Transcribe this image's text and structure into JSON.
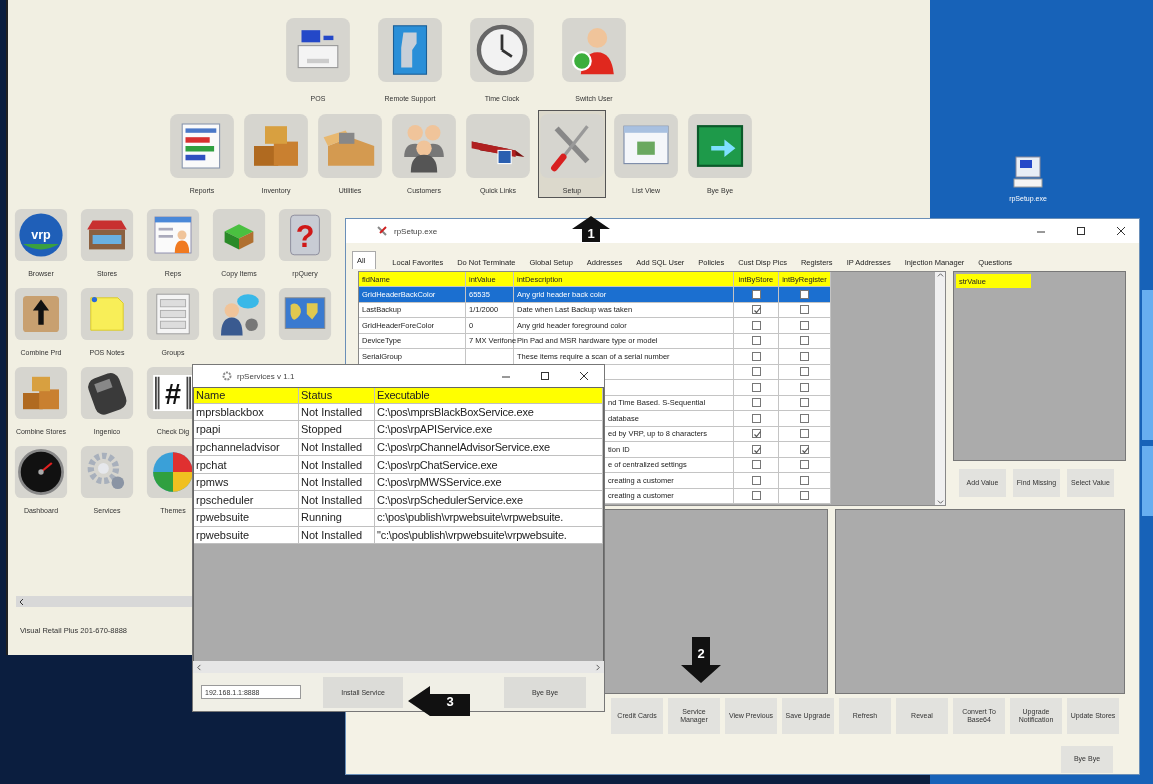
{
  "app": {
    "top_launchers": [
      {
        "label": "POS",
        "selected": false
      },
      {
        "label": "Remote Support",
        "selected": false
      },
      {
        "label": "Time Clock",
        "selected": false
      },
      {
        "label": "Switch User",
        "selected": false
      }
    ],
    "main_launchers": [
      {
        "label": "Reports",
        "selected": false
      },
      {
        "label": "Inventory",
        "selected": false
      },
      {
        "label": "Utilities",
        "selected": false
      },
      {
        "label": "Customers",
        "selected": false
      },
      {
        "label": "Quick Links",
        "selected": false
      },
      {
        "label": "Setup",
        "selected": true
      },
      {
        "label": "List View",
        "selected": false
      },
      {
        "label": "Bye Bye",
        "selected": false
      }
    ],
    "side_launchers": [
      {
        "label": "Browser",
        "badge": "vrp"
      },
      {
        "label": "Stores"
      },
      {
        "label": "Reps"
      },
      {
        "label": "Copy Items"
      },
      {
        "label": "rpQuery",
        "badge": "?"
      },
      {
        "label": "Combine Prd"
      },
      {
        "label": "POS Notes"
      },
      {
        "label": "Groups"
      },
      {
        "label": "Combine Stores"
      },
      {
        "label": "Ingenico"
      },
      {
        "label": "Check Dig",
        "badge": "#"
      },
      {
        "label": "Dashboard"
      },
      {
        "label": "Services"
      },
      {
        "label": "Themes"
      }
    ],
    "status_text": "Visual Retail Plus 201-670-8888"
  },
  "desktop_icons": [
    {
      "label": "rpSetup.exe"
    }
  ],
  "setup_window": {
    "title": "rpSetup.exe",
    "tabs": [
      {
        "label": "All",
        "selected": true
      },
      {
        "label": "Local Favorites",
        "selected": false
      },
      {
        "label": "Do Not Terminate",
        "selected": false
      },
      {
        "label": "Global Setup",
        "selected": false
      },
      {
        "label": "Addresses",
        "selected": false
      },
      {
        "label": "Add SQL User",
        "selected": false
      },
      {
        "label": "Policies",
        "selected": false
      },
      {
        "label": "Cust Disp Pics",
        "selected": false
      },
      {
        "label": "Registers",
        "selected": false
      },
      {
        "label": "IP Addresses",
        "selected": false
      },
      {
        "label": "Injection Manager",
        "selected": false
      },
      {
        "label": "Questions",
        "selected": false
      }
    ],
    "grid": {
      "columns": [
        "fldName",
        "intValue",
        "intDescription",
        "intByStore",
        "intByRegister"
      ],
      "rows": [
        {
          "kind": "full",
          "name": "GridHeaderBackColor",
          "value": "65535",
          "description": "Any grid header back color",
          "by_store": false,
          "by_register": false,
          "selected": true
        },
        {
          "kind": "full",
          "name": "LastBackup",
          "value": "1/1/2000",
          "description": "Date when Last Backup was taken",
          "by_store": true,
          "by_register": false,
          "selected": false
        },
        {
          "kind": "full",
          "name": "GridHeaderForeColor",
          "value": "0",
          "description": "Any grid header foreground color",
          "by_store": false,
          "by_register": false,
          "selected": false
        },
        {
          "kind": "full",
          "name": "DeviceType",
          "value": "7 MX Verifone",
          "description": "Pin Pad and MSR hardware type or model",
          "by_store": false,
          "by_register": false,
          "selected": false
        },
        {
          "kind": "full",
          "name": "SerialGroup",
          "description": "These items require a scan of a serial number",
          "by_store": false,
          "by_register": false,
          "selected": false
        },
        {
          "kind": "covered",
          "by_store": false,
          "by_register": false,
          "selected": false
        },
        {
          "kind": "covered",
          "by_store": false,
          "by_register": false,
          "selected": false
        },
        {
          "kind": "covered",
          "description": "nd Time Based. S-Sequential",
          "by_store": false,
          "by_register": false,
          "selected": false
        },
        {
          "kind": "covered",
          "description": "database",
          "by_store": false,
          "by_register": false,
          "selected": false
        },
        {
          "kind": "covered",
          "description": "ed by VRP, up to 8 characters",
          "by_store": true,
          "by_register": false,
          "selected": false
        },
        {
          "kind": "covered",
          "description": "tion ID",
          "by_store": true,
          "by_register": true,
          "selected": false
        },
        {
          "kind": "covered",
          "description": "e of centralized settings",
          "by_store": false,
          "by_register": false,
          "selected": false
        },
        {
          "kind": "covered",
          "description": "creating a customer",
          "by_store": false,
          "by_register": false,
          "selected": false
        },
        {
          "kind": "covered",
          "description": "creating a customer",
          "by_store": false,
          "by_register": false,
          "selected": false
        }
      ]
    },
    "value_panel": {
      "column": "strValue"
    },
    "value_buttons": [
      "Add Value",
      "Find Missing",
      "Select Value"
    ],
    "buttons": [
      "Credit Cards",
      "Service Manager",
      "View Previous",
      "Save Upgrade",
      "Refresh",
      "Reveal",
      "Convert To Base64",
      "Upgrade Notification",
      "Update Stores"
    ],
    "close_button": "Bye Bye"
  },
  "services_window": {
    "title": "rpServices v 1.1",
    "columns": [
      "Name",
      "Status",
      "Executable"
    ],
    "rows": [
      {
        "name": "mprsblackbox",
        "status": "Not Installed",
        "executable": "C:\\pos\\mprsBlackBoxService.exe"
      },
      {
        "name": "rpapi",
        "status": "Stopped",
        "executable": "C:\\pos\\rpAPIService.exe"
      },
      {
        "name": "rpchanneladvisor",
        "status": "Not Installed",
        "executable": "C:\\pos\\rpChannelAdvisorService.exe"
      },
      {
        "name": "rpchat",
        "status": "Not Installed",
        "executable": "C:\\pos\\rpChatService.exe"
      },
      {
        "name": "rpmws",
        "status": "Not Installed",
        "executable": "C:\\pos\\rpMWSService.exe"
      },
      {
        "name": "rpscheduler",
        "status": "Not Installed",
        "executable": "C:\\pos\\rpSchedulerService.exe"
      },
      {
        "name": "rpwebsuite",
        "status": "Running",
        "executable": "c:\\pos\\publish\\vrpwebsuite\\vrpwebsuite."
      },
      {
        "name": "rpwebsuite",
        "status": "Not Installed",
        "executable": "\"c:\\pos\\publish\\vrpwebsuite\\vrpwebsuite."
      }
    ],
    "address": "192.168.1.1:8888",
    "install_button": "Install Service",
    "close_button": "Bye Bye"
  },
  "callouts": [
    {
      "number": "1",
      "kind": "up"
    },
    {
      "number": "2",
      "kind": "down"
    },
    {
      "number": "3",
      "kind": "left"
    }
  ]
}
